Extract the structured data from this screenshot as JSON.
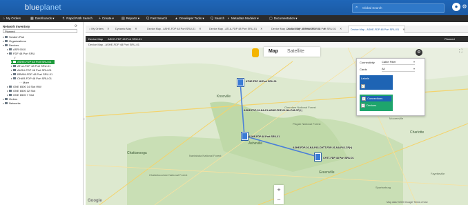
{
  "app": {
    "logo_a": "blue",
    "logo_b": "planet",
    "search_placeholder": "Global Search"
  },
  "menubar": [
    {
      "icon": "⌂",
      "label": "My Orders"
    },
    {
      "icon": "▦",
      "label": "Dashboards ▾"
    },
    {
      "icon": "↯",
      "label": "Rapid Path Search"
    },
    {
      "icon": "+",
      "label": "Create ▾"
    },
    {
      "icon": "▤",
      "label": "Reports ▾"
    },
    {
      "icon": "Q",
      "label": "Fast Search"
    },
    {
      "icon": "▲",
      "label": "Developer Tools ▾"
    },
    {
      "icon": "Q",
      "label": "Search"
    },
    {
      "icon": "◐",
      "label": "Metadata Modeler ▾"
    },
    {
      "icon": "▢",
      "label": "Documentation ▾"
    }
  ],
  "left_panel": {
    "title": "Network Inventory",
    "select": "Planned",
    "tree": [
      "Scratch Pad",
      "Organizations",
      "Devices",
      "ASR 9010",
      "FDF 48 Port SRU",
      "",
      "ASHE-FDP 48 Port SRU-01",
      "ATLA-FDP 48 Port SRU-01",
      "AUSU-FDP 48 Port SRU-01",
      "BRWM-FDP 48 Port SRU-01",
      "CHAR-FDP 48 Port SRU-01",
      "More",
      "ONE 6500 14 Slot WW",
      "ONE 6500 32 Slot",
      "ONE 6500 7 Slot",
      "Orders",
      "Networks"
    ]
  },
  "tabs": [
    {
      "label": "My Orders",
      "active": false
    },
    {
      "label": "Dynamic Map",
      "active": false
    },
    {
      "label": "Device Map - ASHE-FDP 48 Port SRU-01",
      "active": false
    },
    {
      "label": "Device Map - ATLA-FDP 48 Port SRU-01",
      "active": false
    },
    {
      "label": "Device Map - AUSU-FDP 48 Port SRU-01",
      "active": false
    },
    {
      "label": "Device Map - BRWM-FDP 48 Port SRU-01",
      "active": false
    },
    {
      "label": "Device Map - ASHE-FDP 48 Port SRU-01",
      "active": true
    }
  ],
  "header2": {
    "left": "Device Map",
    "title": "ASHE-FDP 48 Port SRU-01",
    "right": "Planned"
  },
  "viewbar": {
    "label": "Device Map - ASHE-FDP 48 Port SRU-01"
  },
  "map": {
    "type_map": "Map",
    "type_satellite": "Satellite",
    "labels": [
      "Knoxville",
      "Cherokee National Forest",
      "Pisgah National Forest",
      "Nantahala National Forest",
      "Chattahoochee National Forest",
      "Greenville",
      "Asheville",
      "Fayetteville",
      "Chattanooga",
      "Charlotte",
      "Mooresville",
      "Spartanburg"
    ],
    "nodes": [
      {
        "label": "ATHE-FDP 48 Port SRU-01"
      },
      {
        "label": "ASHE-FDP 48 Port SRU-01"
      },
      {
        "label": "CHTT-FDP 48 Port SRU-01"
      }
    ],
    "links": [
      "ASHE-FDP-01-NA-P4-ASHE-FDP-01-NA-P48-CP(+)",
      "ASHE-FDP-01-NA-P43-CHTT-FDP-01-NA-P43-CP(+)"
    ]
  },
  "panel": {
    "connectivity_label": "Connectivity",
    "connectivity_value": "Cable Fiber",
    "cards_label": "Cards",
    "cards_value": "All",
    "labels_title": "Labels",
    "opt_connections": "Connections",
    "opt_devices": "Devices"
  },
  "zoom": {
    "plus": "+",
    "minus": "−"
  },
  "footer": {
    "google": "Google",
    "attribution": "Map data ©2020 Google  Terms of Use"
  },
  "colors": {
    "brand": "#1b5aa3",
    "selected": "#1d9a3a",
    "label_box": "#1e64b4",
    "conn_box": "#1ea56c"
  }
}
